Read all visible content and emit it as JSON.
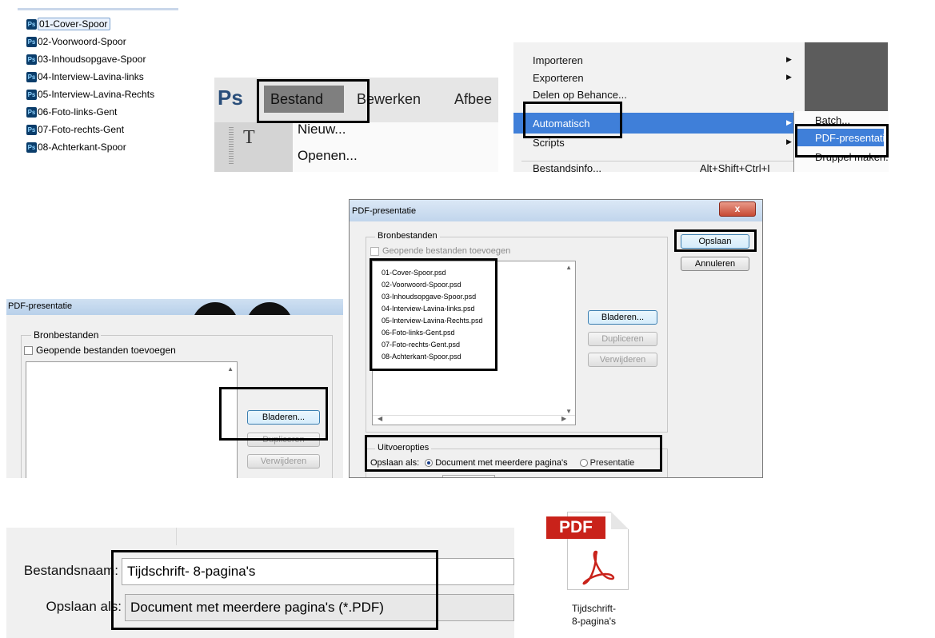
{
  "file_list": {
    "items": [
      "01-Cover-Spoor",
      "02-Voorwoord-Spoor",
      "03-Inhoudsopgave-Spoor",
      "04-Interview-Lavina-links",
      "05-Interview-Lavina-Rechts",
      "06-Foto-links-Gent",
      "07-Foto-rechts-Gent",
      "08-Achterkant-Spoor"
    ],
    "icon": "photoshop-file-icon",
    "icon_text": "Ps"
  },
  "ps_menu": {
    "logo": "Ps",
    "menubar": [
      "Bestand",
      "Bewerken",
      "Afbee"
    ],
    "dropdown": [
      "Nieuw...",
      "Openen..."
    ],
    "tool_glyph": "T"
  },
  "file_menu": {
    "items": [
      "Importeren",
      "Exporteren",
      "Delen op Behance...",
      "Automatisch",
      "Scripts",
      "Bestandsinfo..."
    ],
    "shortcut": "Alt+Shift+Ctrl+I",
    "submenu": [
      "Batch...",
      "PDF-presentatie...",
      "Druppel maken..."
    ]
  },
  "dialog_empty": {
    "title": "PDF-presentatie",
    "group": "Bronbestanden",
    "checkbox": "Geopende bestanden toevoegen",
    "buttons": [
      "Bladeren...",
      "Dupliceren",
      "Verwijderen"
    ]
  },
  "dialog_filled": {
    "title": "PDF-presentatie",
    "close": "x",
    "group": "Bronbestanden",
    "checkbox": "Geopende bestanden toevoegen",
    "files": [
      "01-Cover-Spoor.psd",
      "02-Voorwoord-Spoor.psd",
      "03-Inhoudsopgave-Spoor.psd",
      "04-Interview-Lavina-links.psd",
      "05-Interview-Lavina-Rechts.psd",
      "06-Foto-links-Gent.psd",
      "07-Foto-rechts-Gent.psd",
      "08-Achterkant-Spoor.psd"
    ],
    "side_buttons": [
      "Bladeren...",
      "Dupliceren",
      "Verwijderen"
    ],
    "ok": "Opslaan",
    "cancel": "Annuleren",
    "options_group": "Uitvoeropties",
    "save_as_label": "Opslaan als:",
    "option_doc": "Document met meerdere pagina's",
    "option_pres": "Presentatie"
  },
  "save_dialog": {
    "filename_label": "Bestandsnaam:",
    "filename": "Tijdschrift- 8-pagina's",
    "type_label": "Opslaan als:",
    "type": "Document met meerdere pagina's (*.PDF)"
  },
  "pdf_icon": {
    "badge": "PDF",
    "caption_line1": "Tijdschrift-",
    "caption_line2": "8-pagina's"
  }
}
